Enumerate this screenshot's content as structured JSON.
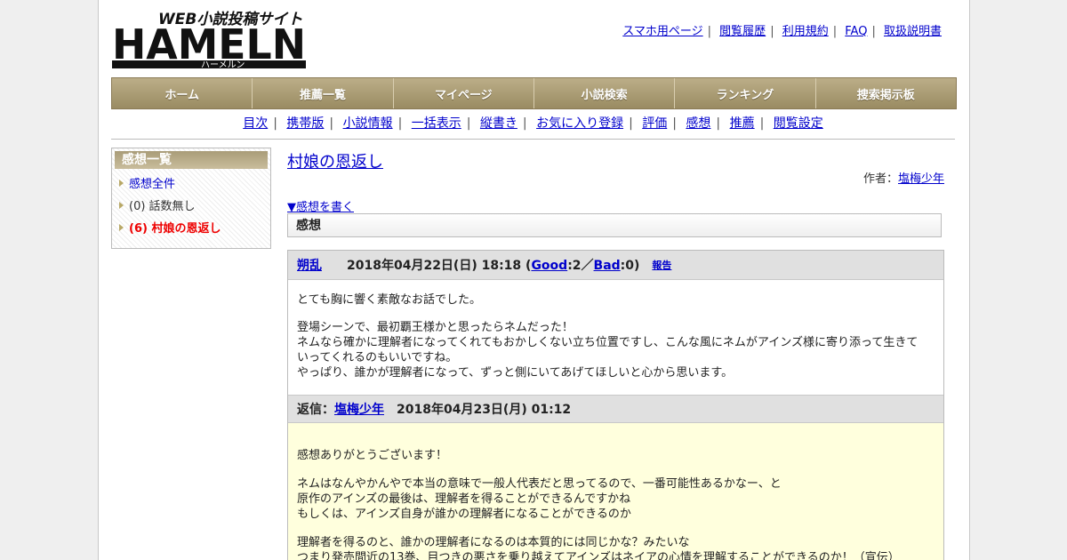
{
  "logo": {
    "tagline": "WEB小説投稿サイト",
    "name": "HAMELN",
    "kana": "ハーメルン"
  },
  "toplinks": [
    "スマホ用ページ",
    "閲覧履歴",
    "利用規約",
    "FAQ",
    "取扱説明書"
  ],
  "mainnav": [
    "ホーム",
    "推薦一覧",
    "マイページ",
    "小説検索",
    "ランキング",
    "捜索掲示板"
  ],
  "subnav": [
    "目次",
    "携帯版",
    "小説情報",
    "一括表示",
    "縦書き",
    "お気に入り登録",
    "評価",
    "感想",
    "推薦",
    "閲覧設定"
  ],
  "sidebar": {
    "title": "感想一覧",
    "all": "感想全件",
    "none": "(0) 話数無し",
    "current": "(6) 村娘の恩返し"
  },
  "novel": {
    "title": "村娘の恩返し",
    "author_label": "作者：",
    "author": "塩梅少年",
    "write_link": "▼感想を書く",
    "section": "感想"
  },
  "review": {
    "user": "朔乱",
    "date_prefix": "2018年04月22日(日) 18:18 (",
    "good": "Good",
    "good_count": ":2／",
    "bad": "Bad",
    "bad_count": ":0)",
    "report": "報告",
    "paragraphs": [
      "とても胸に響く素敵なお話でした。",
      "登場シーンで、最初覇王様かと思ったらネムだった！\nネムなら確かに理解者になってくれてもおかしくない立ち位置ですし、こんな風にネムがアインズ様に寄り添って生きて\nいってくれるのもいいですね。\nやっぱり、誰かが理解者になって、ずっと側にいてあげてほしいと心から思います。"
    ]
  },
  "reply": {
    "label": "返信：",
    "user": "塩梅少年",
    "date": "2018年04月23日(月) 01:12",
    "paragraphs": [
      "感想ありがとうございます！",
      "ネムはなんやかんやで本当の意味で一般人代表だと思ってるので、一番可能性あるかなー、と\n原作のアインズの最後は、理解者を得ることができるんですかね\nもしくは、アインズ自身が誰かの理解者になることができるのか",
      "理解者を得るのと、誰かの理解者になるのは本質的には同じかな？みたいな\nつまり発売間近の13巻、目つきの悪さを乗り越えてアインズはネイアの心情を理解することができるのか！（宣伝）"
    ]
  }
}
